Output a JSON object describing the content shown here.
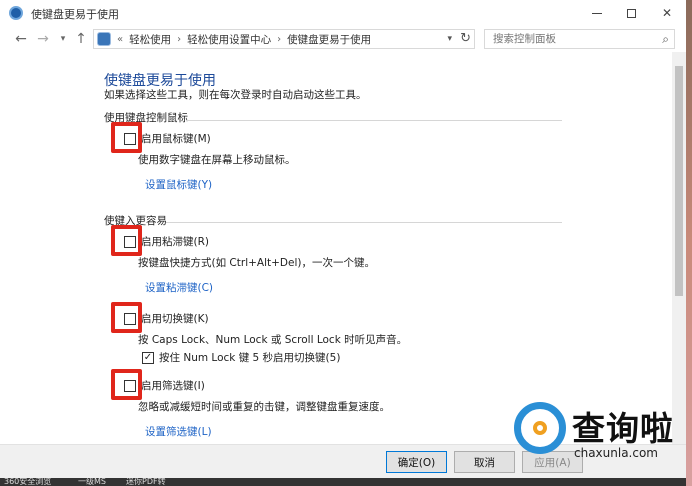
{
  "window": {
    "title": "使键盘更易于使用"
  },
  "address": {
    "root_glyph": "«",
    "crumbs": [
      "轻松使用",
      "轻松使用设置中心",
      "使键盘更易于使用"
    ],
    "search_placeholder": "搜索控制面板"
  },
  "page": {
    "title": "使键盘更易于使用",
    "description": "如果选择这些工具，则在每次登录时自动启动这些工具。"
  },
  "sections": [
    {
      "heading": "使用键盘控制鼠标",
      "items": [
        {
          "label": "启用鼠标键(M)",
          "checked": false,
          "description": "使用数字键盘在屏幕上移动鼠标。",
          "link": "设置鼠标键(Y)"
        }
      ]
    },
    {
      "heading": "使键入更容易",
      "items": [
        {
          "label": "启用粘滞键(R)",
          "checked": false,
          "description": "按键盘快捷方式(如 Ctrl+Alt+Del)，一次一个键。",
          "link": "设置粘滞键(C)"
        },
        {
          "label": "启用切换键(K)",
          "checked": false,
          "description": "按 Caps Lock、Num Lock 或 Scroll Lock 时听见声音。",
          "sub_option": {
            "label": "按住 Num Lock 键 5 秒启用切换键(5)",
            "checked": true
          }
        },
        {
          "label": "启用筛选键(I)",
          "checked": false,
          "description": "忽略或减缓短时间或重复的击键，调整键盘重复速度。",
          "link": "设置筛选键(L)"
        }
      ]
    }
  ],
  "footer": {
    "ok": "确定(O)",
    "cancel": "取消",
    "apply": "应用(A)"
  },
  "taskbar": [
    "360安全浏览",
    "一级MS",
    "迷你PDF转"
  ],
  "watermark": {
    "text": "查询啦",
    "sub": "chaxunla.com"
  },
  "colors": {
    "highlight": "#e0261b",
    "link": "#1e63c6",
    "title": "#1d4a9a"
  }
}
